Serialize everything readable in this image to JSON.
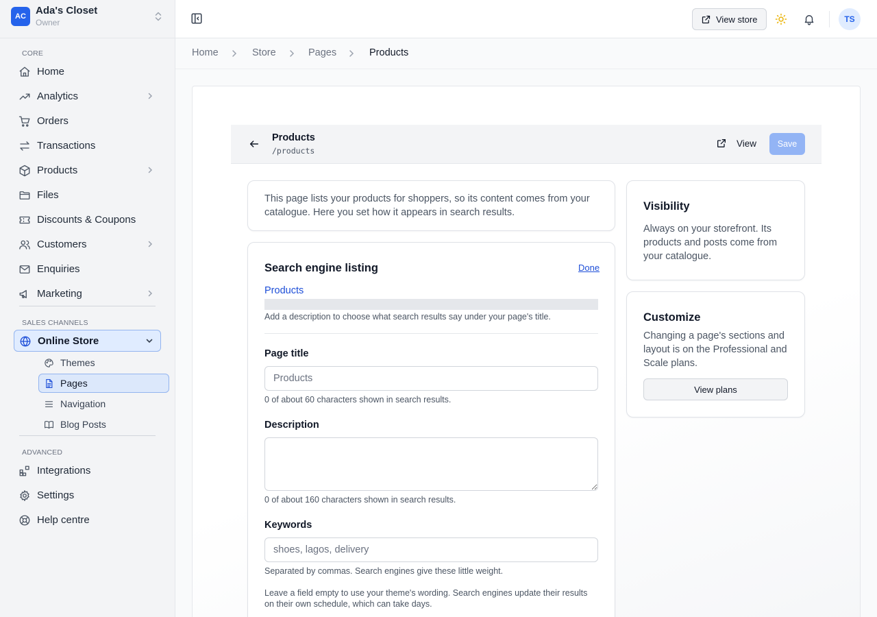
{
  "store": {
    "initials": "AC",
    "name": "Ada's Closet",
    "role": "Owner"
  },
  "sidebar": {
    "core_label": "CORE",
    "core_items": [
      {
        "label": "Home",
        "icon": "home-icon"
      },
      {
        "label": "Analytics",
        "icon": "trending-up-icon",
        "expandable": true
      },
      {
        "label": "Orders",
        "icon": "cart-icon"
      },
      {
        "label": "Transactions",
        "icon": "arrows-swap-icon"
      },
      {
        "label": "Products",
        "icon": "box-icon",
        "expandable": true
      },
      {
        "label": "Files",
        "icon": "folder-icon"
      },
      {
        "label": "Discounts & Coupons",
        "icon": "ticket-icon"
      },
      {
        "label": "Customers",
        "icon": "users-icon",
        "expandable": true
      },
      {
        "label": "Enquiries",
        "icon": "mail-icon"
      },
      {
        "label": "Marketing",
        "icon": "megaphone-icon",
        "expandable": true
      }
    ],
    "channels_label": "SALES CHANNELS",
    "online_store": {
      "label": "Online Store",
      "icon": "globe-icon",
      "expanded": true
    },
    "online_store_sub": [
      {
        "label": "Themes",
        "icon": "palette-icon"
      },
      {
        "label": "Pages",
        "icon": "document-icon",
        "active": true
      },
      {
        "label": "Navigation",
        "icon": "menu-lines-icon"
      },
      {
        "label": "Blog Posts",
        "icon": "book-icon"
      }
    ],
    "advanced_label": "ADVANCED",
    "advanced_items": [
      {
        "label": "Integrations",
        "icon": "blocks-icon"
      },
      {
        "label": "Settings",
        "icon": "gear-icon"
      },
      {
        "label": "Help centre",
        "icon": "lifebuoy-icon"
      }
    ]
  },
  "topbar": {
    "view_store_label": "View store",
    "avatar_initials": "TS"
  },
  "breadcrumb": [
    "Home",
    "Store",
    "Pages",
    "Products"
  ],
  "page_header": {
    "title": "Products",
    "slug": "/products",
    "view_label": "View",
    "save_label": "Save"
  },
  "info_text": "This page lists your products for shoppers, so its content comes from your catalogue. Here you set how it appears in search results.",
  "seo": {
    "title": "Search engine listing",
    "done_label": "Done",
    "preview_title": "Products",
    "preview_hint": "Add a description to choose what search results say under your page's title.",
    "page_title_label": "Page title",
    "page_title_placeholder": "Products",
    "page_title_help": "0 of about 60 characters shown in search results.",
    "description_label": "Description",
    "description_help": "0 of about 160 characters shown in search results.",
    "keywords_label": "Keywords",
    "keywords_placeholder": "shoes, lagos, delivery",
    "keywords_help": "Separated by commas. Search engines give these little weight.",
    "footer_note": "Leave a field empty to use your theme's wording. Search engines update their results on their own schedule, which can take days."
  },
  "visibility": {
    "title": "Visibility",
    "text": "Always on your storefront. Its products and posts come from your catalogue."
  },
  "customize": {
    "title": "Customize",
    "text": "Changing a page's sections and layout is on the Professional and Scale plans.",
    "button_label": "View plans"
  },
  "colors": {
    "accent": "#2563eb",
    "active_bg": "#e0ecff",
    "save_disabled": "#93b4f5",
    "link": "#1d4ed8"
  }
}
